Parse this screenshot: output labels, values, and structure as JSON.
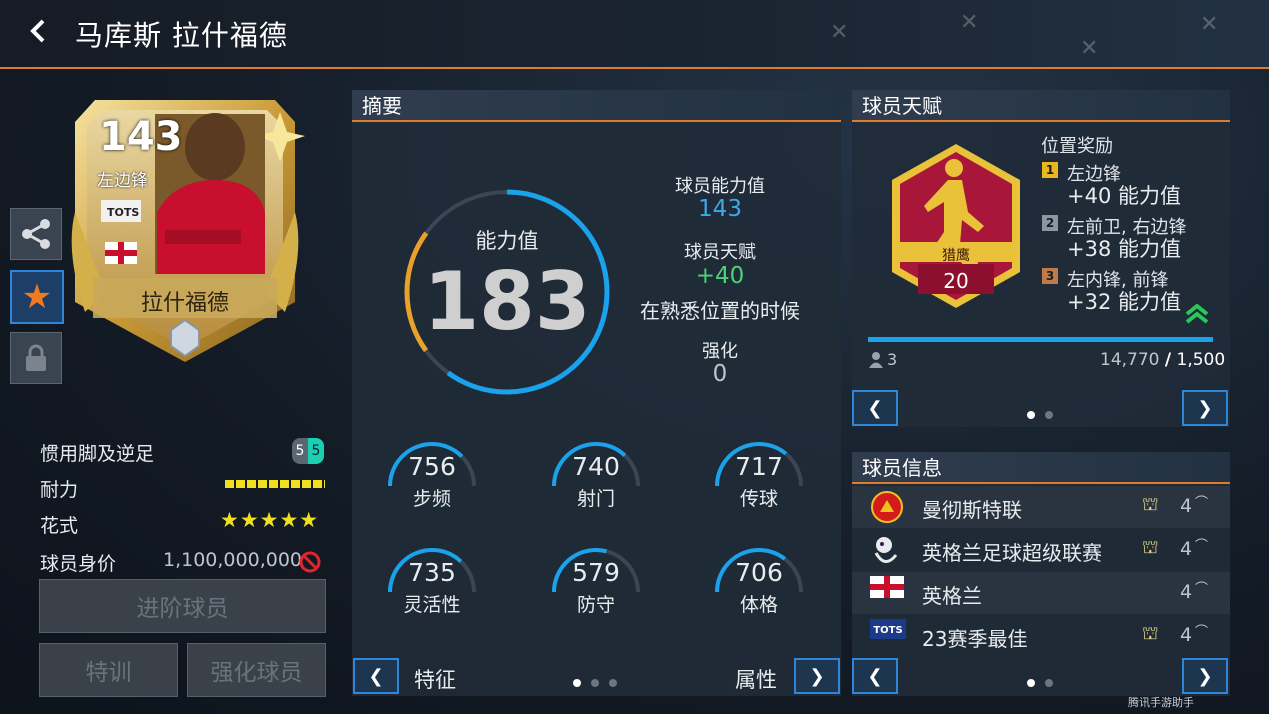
{
  "header": {
    "title": "马库斯 拉什福德"
  },
  "card": {
    "rating": "143",
    "position": "左边锋",
    "badge": "TOTS",
    "name": "拉什福德",
    "colors": {
      "gold": "#d4b04a",
      "shirt": "#c8102e"
    }
  },
  "side_buttons": [
    "share-icon",
    "star-icon",
    "lock-icon"
  ],
  "stats": {
    "foot_label": "惯用脚及逆足",
    "foot_value_a": "5",
    "foot_value_b": "5",
    "stamina_label": "耐力",
    "skill_label": "花式",
    "skill_stars": "★★★★★",
    "price_label": "球员身价",
    "price_value": "1,100,000,000"
  },
  "buttons": {
    "advance": "进阶球员",
    "train": "特训",
    "boost": "强化球员"
  },
  "summary": {
    "title": "摘要",
    "ovr_label": "能力值",
    "ovr_value": "183",
    "ovr_progress": 0.85,
    "player_ovr_label": "球员能力值",
    "player_ovr_value": "143",
    "talent_label": "球员天赋",
    "talent_value": "+40",
    "talent_note": "在熟悉位置的时候",
    "boost_label": "强化",
    "boost_value": "0",
    "attributes": [
      {
        "value": "756",
        "label": "步频",
        "fill": 0.75
      },
      {
        "value": "740",
        "label": "射门",
        "fill": 0.74
      },
      {
        "value": "717",
        "label": "传球",
        "fill": 0.72
      },
      {
        "value": "735",
        "label": "灵活性",
        "fill": 0.74
      },
      {
        "value": "579",
        "label": "防守",
        "fill": 0.58
      },
      {
        "value": "706",
        "label": "体格",
        "fill": 0.71
      }
    ],
    "footer_left": "特征",
    "footer_right": "属性"
  },
  "talent": {
    "title": "球员天赋",
    "trait_name": "猎鹰",
    "trait_level": "20",
    "bonus_title": "位置奖励",
    "bonuses": [
      {
        "rank": "1",
        "positions": "左边锋",
        "value": "+40 能力值",
        "color": "#e8b820"
      },
      {
        "rank": "2",
        "positions": "左前卫, 右边锋",
        "value": "+38 能力值",
        "color": "#8a96a3"
      },
      {
        "rank": "3",
        "positions": "左内锋, 前锋",
        "value": "+32 能力值",
        "color": "#c07a4a"
      }
    ],
    "count": "3",
    "progress_current": "14,770",
    "progress_total": "1,500"
  },
  "info": {
    "title": "球员信息",
    "rows": [
      {
        "icon": "club-crest-icon",
        "name": "曼彻斯特联",
        "num": "4"
      },
      {
        "icon": "league-icon",
        "name": "英格兰足球超级联赛",
        "num": "4"
      },
      {
        "icon": "england-flag-icon",
        "name": "英格兰",
        "num": "4"
      },
      {
        "icon": "tots-icon",
        "name": "23赛季最佳",
        "num": "4"
      }
    ],
    "watermark": "腾讯手游助手"
  }
}
